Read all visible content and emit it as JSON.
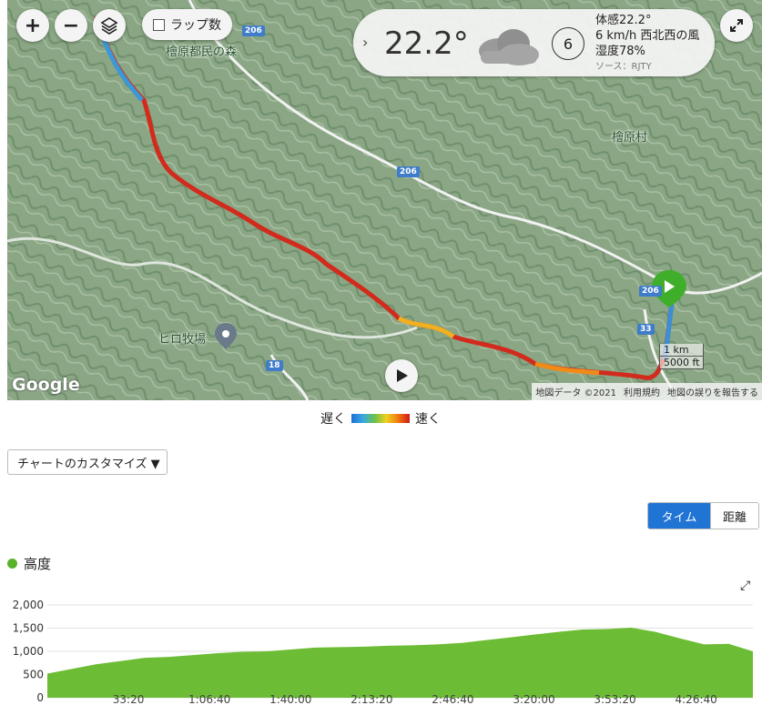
{
  "map": {
    "zoom_in": "+",
    "zoom_out": "−",
    "lap_label": "ラップ数",
    "place_label_top": "檜原都民の森",
    "place_label_village": "檜原村",
    "place_label_ranch": "ヒロ牧場",
    "road_206": "206",
    "road_33": "33",
    "road_18": "18",
    "scale_km": "1 km",
    "scale_ft": "5000 ft",
    "attribution_data": "地図データ ©2021",
    "attribution_terms": "利用規約",
    "attribution_report": "地図の誤りを報告する",
    "google_logo": "Google"
  },
  "weather": {
    "temp": "22.2°",
    "wind_speed_circle": "6",
    "feels_like": "体感22.2°",
    "wind": "6 km/h 西北西の風",
    "humidity": "湿度78%",
    "source": "ソース：RJTY"
  },
  "legend": {
    "slow": "遅く",
    "fast": "速く"
  },
  "customize_label": "チャートのカスタマイズ ▼",
  "toggle": {
    "time": "タイム",
    "distance": "距離"
  },
  "chart_title": "高度",
  "colors": {
    "chart_fill": "#6cbd35",
    "accent": "#1f74d4"
  },
  "chart_data": {
    "type": "area",
    "title": "高度",
    "ylim": [
      0,
      2000
    ],
    "y_ticks": [
      "2,000",
      "1,500",
      "1,000",
      "500",
      "0"
    ],
    "x_ticks": [
      "33:20",
      "1:06:40",
      "1:40:00",
      "2:13:20",
      "2:46:40",
      "3:20:00",
      "3:53:20",
      "4:26:40"
    ],
    "x_seconds": [
      0,
      600,
      1200,
      1800,
      2400,
      3000,
      3600,
      4200,
      4800,
      5400,
      6000,
      6600,
      7200,
      7800,
      8400,
      9000,
      9600,
      10200,
      10800,
      11400,
      12000,
      12600,
      13200,
      13800,
      14400,
      15000,
      15600,
      16200,
      16800,
      17400
    ],
    "values": [
      520,
      620,
      720,
      790,
      860,
      880,
      920,
      960,
      990,
      1000,
      1040,
      1080,
      1090,
      1100,
      1120,
      1130,
      1150,
      1180,
      1240,
      1300,
      1360,
      1420,
      1470,
      1480,
      1510,
      1420,
      1280,
      1150,
      1160,
      1000
    ]
  }
}
